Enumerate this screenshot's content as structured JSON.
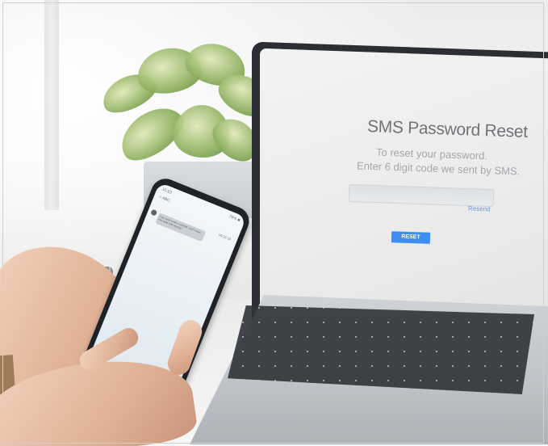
{
  "laptop": {
    "title": "SMS Password Reset",
    "line1": "To reset your password.",
    "line2": "Enter 6 digit code we sent by SMS.",
    "input_placeholder": "",
    "resend_label": "Resend",
    "reset_label": "RESET"
  },
  "phone": {
    "time": "10:10",
    "status": "76% ■",
    "back_label": "< ABC",
    "date": "09:23 19",
    "message": "Your reset code is 123456. Don't share this code with anyone."
  },
  "colors": {
    "reset_button": "#3d8ef2",
    "resend_link": "#6a9ad8"
  }
}
